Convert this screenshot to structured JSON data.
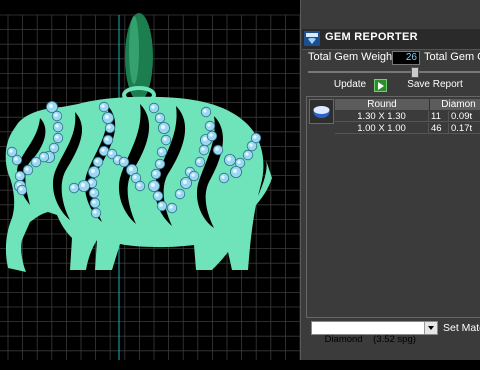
{
  "panel": {
    "title": "GEM REPORTER",
    "total_weight_label": "Total Gem Weight",
    "total_weight_value": "26",
    "total_count_label": "Total Gem Co",
    "slider_value": 0.6,
    "update_label": "Update",
    "save_label": "Save Report",
    "table": {
      "headers": [
        "Round",
        "Diamon"
      ],
      "rows": [
        {
          "size": "1.30 X 1.30",
          "count": "11",
          "weight": "0.09t"
        },
        {
          "size": "1.00 X 1.00",
          "count": "46",
          "weight": "0.17t"
        }
      ]
    },
    "material_value": "Diamond    (3.52 spg)",
    "set_material_label": "Set Mate"
  },
  "colors": {
    "model": "#6fe3b9",
    "grid": "#3a3a3a",
    "gem": "#9ad8f2",
    "bail": "#1f8a58",
    "accent_axis": "#19b3b3"
  },
  "icons": {
    "app": "gem-reporter-icon",
    "gem": "round-gem-icon",
    "play": "play-icon",
    "dropdown": "chevron-down-icon"
  }
}
